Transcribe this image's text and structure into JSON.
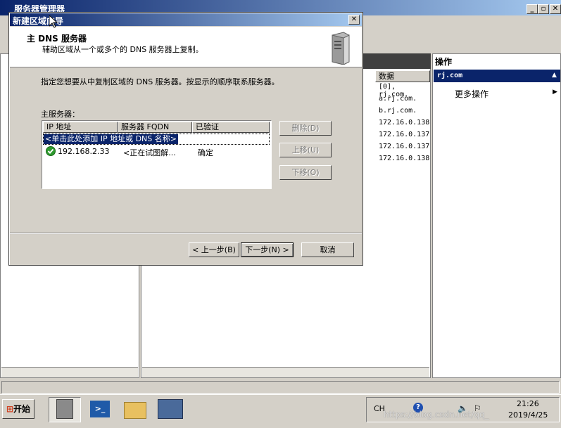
{
  "main_window": {
    "title": "服务器管理器",
    "data_column_header": "数据",
    "data_rows": [
      "[0], rj.com.",
      "a.rj.com.",
      "b.rj.com.",
      "172.16.0.138",
      "172.16.0.137",
      "172.16.0.137",
      "172.16.0.138"
    ]
  },
  "actions_panel": {
    "title": "操作",
    "section": "rj.com",
    "more_actions": "更多操作"
  },
  "wizard": {
    "title": "新建区域向导",
    "header_title": "主 DNS 服务器",
    "header_subtitle": "辅助区域从一个或多个的 DNS 服务器上复制。",
    "instruction": "指定您想要从中复制区域的 DNS 服务器。按显示的顺序联系服务器。",
    "list_label": "主服务器：",
    "columns": [
      "IP 地址",
      "服务器 FQDN",
      "已验证"
    ],
    "placeholder_row": "<单击此处添加 IP 地址或 DNS 名称>",
    "rows": [
      {
        "ip": "192.168.2.33",
        "fqdn": "<正在试图解...",
        "verified": "确定"
      }
    ],
    "buttons": {
      "delete": "删除(D)",
      "up": "上移(U)",
      "down": "下移(O)",
      "back": "< 上一步(B)",
      "next": "下一步(N) >",
      "cancel": "取消"
    }
  },
  "taskbar": {
    "start": "开始",
    "lang": "CH",
    "time": "21:26",
    "date": "2019/4/25",
    "watermark": "https://blog.csdn.net/qq_"
  }
}
